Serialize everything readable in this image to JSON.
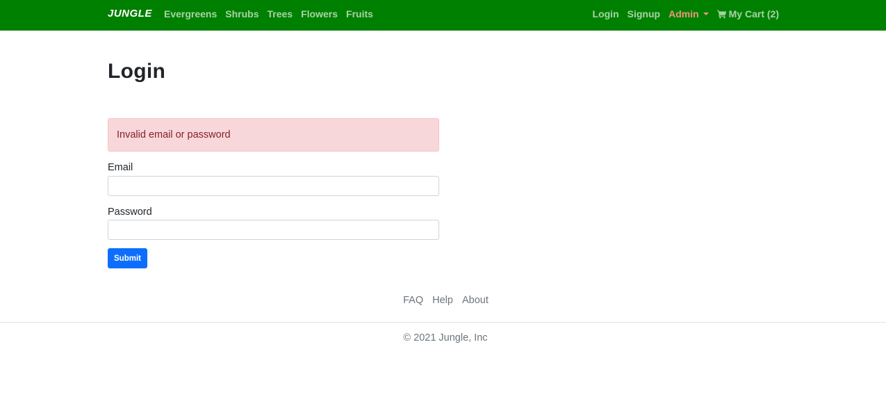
{
  "navbar": {
    "brand": "JUNGLE",
    "categories": [
      {
        "label": "Evergreens"
      },
      {
        "label": "Shrubs"
      },
      {
        "label": "Trees"
      },
      {
        "label": "Flowers"
      },
      {
        "label": "Fruits"
      }
    ],
    "login_label": "Login",
    "signup_label": "Signup",
    "admin_label": "Admin",
    "cart_label": "My Cart (2)",
    "colors": {
      "background": "#008000",
      "admin": "#f0967c"
    },
    "icons": {
      "admin_toggle": "caret-down-icon",
      "cart": "shopping-cart-icon"
    }
  },
  "main": {
    "title": "Login",
    "alert": {
      "message": "Invalid email or password",
      "color": "#f8d7da"
    },
    "form": {
      "email_label": "Email",
      "email_value": "",
      "password_label": "Password",
      "password_value": "",
      "submit_label": "Submit",
      "submit_color": "#0d6efd"
    }
  },
  "footer": {
    "links": [
      {
        "label": "FAQ"
      },
      {
        "label": "Help"
      },
      {
        "label": "About"
      }
    ],
    "copyright": "© 2021 Jungle, Inc"
  }
}
